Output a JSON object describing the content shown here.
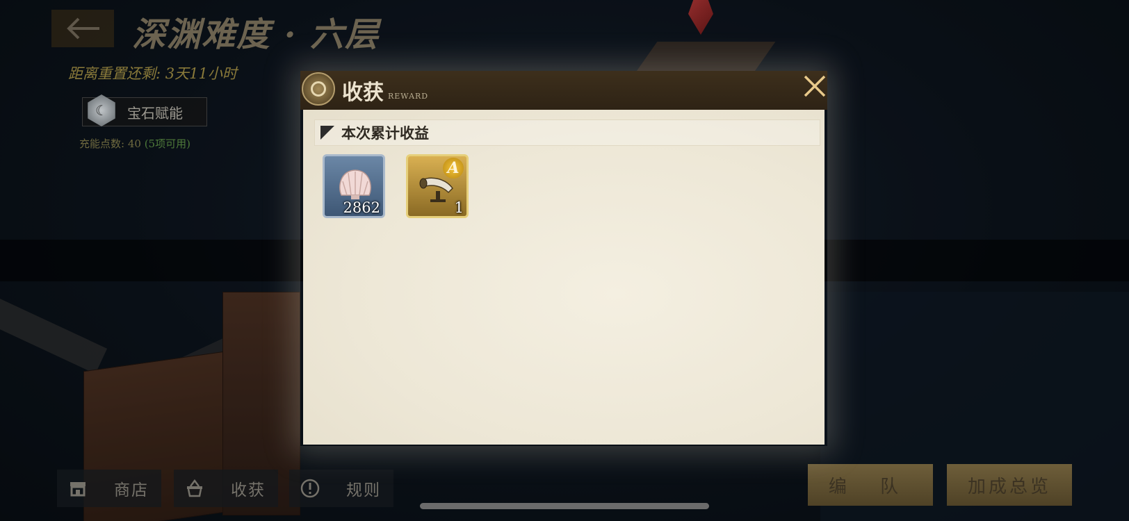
{
  "stage": {
    "title": "深渊难度 · 六层",
    "reset_timer": "距离重置还剩: 3天11小时"
  },
  "gem_panel": {
    "label": "宝石赋能",
    "charge_label": "充能点数: 40",
    "charge_available": "(5项可用)"
  },
  "bottom_menu": [
    {
      "label": "商店",
      "icon": "shop-icon"
    },
    {
      "label": "收获",
      "icon": "basket-icon"
    },
    {
      "label": "规则",
      "icon": "info-icon"
    }
  ],
  "right_buttons": {
    "team": "编 队",
    "bonus": "加成总览"
  },
  "dialog": {
    "title": "收获",
    "subtitle": "REWARD",
    "section_title": "本次累计收益",
    "items": [
      {
        "name": "shell",
        "icon": "shell-icon",
        "count": "2862",
        "rarity": "blue"
      },
      {
        "name": "horn",
        "icon": "horn-icon",
        "count": "1",
        "rank": "A",
        "rarity": "gold"
      }
    ]
  },
  "colors": {
    "gold_accent": "#d9b052",
    "dialog_header": "#3d2f1c",
    "dialog_body": "#f0eadb"
  }
}
